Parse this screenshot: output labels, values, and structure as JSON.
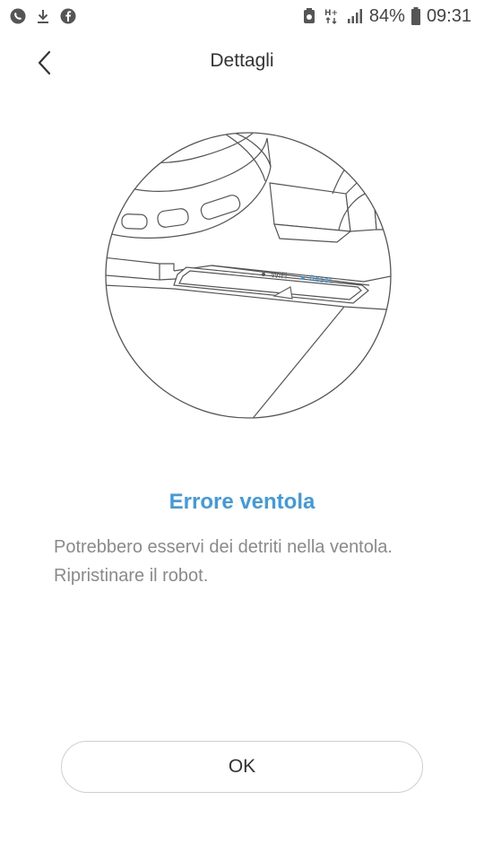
{
  "status_bar": {
    "icons_left": [
      "whatsapp-icon",
      "download-icon",
      "facebook-icon"
    ],
    "icons_right": [
      "notification-icon",
      "hplus-network-icon",
      "signal-icon",
      "battery-icon"
    ],
    "network": "H+",
    "battery": "84%",
    "time": "09:31"
  },
  "header": {
    "title": "Dettagli",
    "back_icon": "chevron-left-icon"
  },
  "illustration": {
    "wifi_label": "WiFi",
    "reset_label": "Reset",
    "accent_color": "#3f9be0"
  },
  "error": {
    "title": "Errore ventola",
    "description": "Potrebbero esservi dei detriti nella ventola. Ripristinare il robot."
  },
  "actions": {
    "ok_label": "OK"
  }
}
